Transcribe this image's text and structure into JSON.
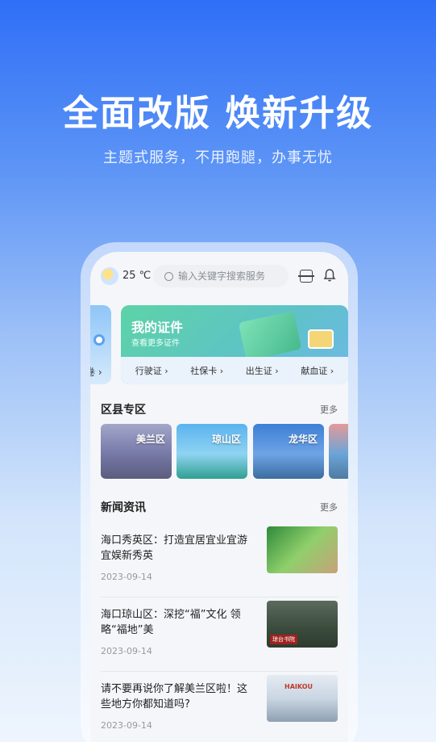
{
  "hero": {
    "title": "全面改版 焕新升级",
    "subtitle": "主题式服务，不用跑腿，办事无忧"
  },
  "topbar": {
    "temperature": "25 ℃",
    "search_placeholder": "输入关键字搜索服务"
  },
  "cards": {
    "left_fragment": "卷 ›",
    "main_title": "我的证件",
    "main_subtitle": "查看更多证件",
    "links": [
      "行驶证 ›",
      "社保卡 ›",
      "出生证 ›",
      "献血证 ›"
    ]
  },
  "districts": {
    "heading": "区县专区",
    "more": "更多",
    "items": [
      {
        "label": "美兰区"
      },
      {
        "label": "琼山区"
      },
      {
        "label": "龙华区"
      },
      {
        "label": ""
      }
    ]
  },
  "news": {
    "heading": "新闻资讯",
    "more": "更多",
    "items": [
      {
        "title": "海口秀英区：打造宜居宜业宜游宜娱新秀英",
        "date": "2023-09-14",
        "thumb_tag": ""
      },
      {
        "title": "海口琼山区：深挖“福”文化 领略“福地”美",
        "date": "2023-09-14",
        "thumb_tag": "琼台书院"
      },
      {
        "title": "请不要再说你了解美兰区啦！这些地方你都知道吗?",
        "date": "2023-09-14",
        "thumb_tag": "HAIKOU"
      }
    ]
  }
}
